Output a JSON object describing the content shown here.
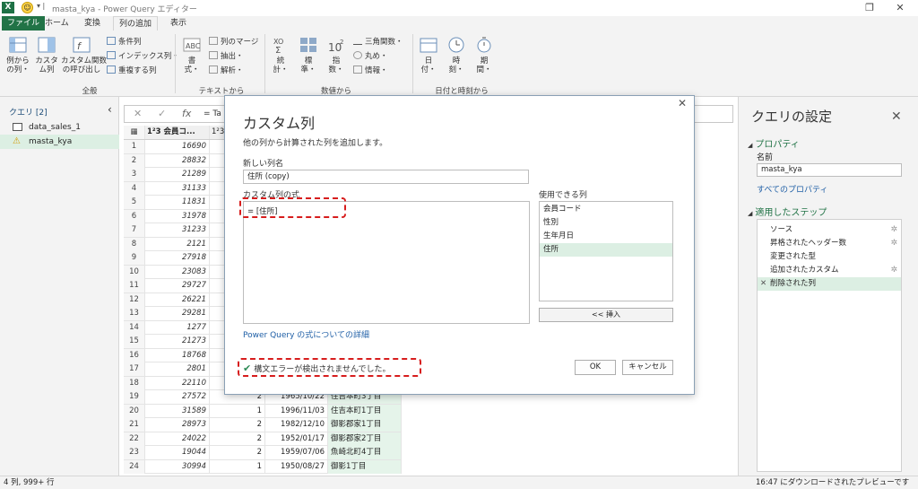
{
  "window": {
    "title": "masta_kya - Power Query エディター",
    "app_icon": "excel-icon",
    "quick_access_icon": "smiley-icon"
  },
  "tabs": [
    "ファイル",
    "ホーム",
    "変換",
    "列の追加",
    "表示"
  ],
  "active_tab": "列の追加",
  "ribbon": {
    "general": {
      "label": "全般",
      "example_column": "例から\nの列・",
      "custom_column": "カスタ\nム列",
      "invoke_function": "カスタム関数\nの呼び出し",
      "conditional_column": "条件列",
      "index_column": "インデックス列・",
      "duplicate_column": "重複する列"
    },
    "text": {
      "label": "テキストから",
      "format": "書\n式・",
      "merge_columns": "列のマージ",
      "extract": "抽出・",
      "parse": "解析・"
    },
    "number": {
      "label": "数値から",
      "statistics": "統\n計・",
      "standard": "標\n準・",
      "scientific": "指\n数・",
      "trigonometry": "三角関数・",
      "rounding": "丸め・",
      "information": "情報・"
    },
    "datetime": {
      "label": "日付と時刻から",
      "date": "日\n付・",
      "time": "時\n刻・",
      "duration": "期\n間・"
    }
  },
  "queries": {
    "header": "クエリ [2]",
    "items": [
      {
        "name": "data_sales_1",
        "icon": "table-icon"
      },
      {
        "name": "masta_kya",
        "icon": "warning-icon"
      }
    ]
  },
  "formula_bar": {
    "cancel": "✕",
    "confirm": "✓",
    "fx": "fx",
    "text": "= Ta"
  },
  "grid": {
    "col1_type": "1²3",
    "col1_header": "会員コ...",
    "col2_type": "1²3",
    "rows": [
      {
        "i": "1",
        "id": "16690",
        "sex": "",
        "dob": "",
        "addr": ""
      },
      {
        "i": "2",
        "id": "28832",
        "sex": "",
        "dob": "",
        "addr": ""
      },
      {
        "i": "3",
        "id": "21289",
        "sex": "",
        "dob": "",
        "addr": ""
      },
      {
        "i": "4",
        "id": "31133",
        "sex": "",
        "dob": "",
        "addr": ""
      },
      {
        "i": "5",
        "id": "11831",
        "sex": "",
        "dob": "",
        "addr": ""
      },
      {
        "i": "6",
        "id": "31978",
        "sex": "",
        "dob": "",
        "addr": ""
      },
      {
        "i": "7",
        "id": "31233",
        "sex": "",
        "dob": "",
        "addr": ""
      },
      {
        "i": "8",
        "id": "2121",
        "sex": "",
        "dob": "",
        "addr": ""
      },
      {
        "i": "9",
        "id": "27918",
        "sex": "",
        "dob": "",
        "addr": ""
      },
      {
        "i": "10",
        "id": "23083",
        "sex": "",
        "dob": "",
        "addr": ""
      },
      {
        "i": "11",
        "id": "29727",
        "sex": "",
        "dob": "",
        "addr": ""
      },
      {
        "i": "12",
        "id": "26221",
        "sex": "",
        "dob": "",
        "addr": ""
      },
      {
        "i": "13",
        "id": "29281",
        "sex": "",
        "dob": "",
        "addr": ""
      },
      {
        "i": "14",
        "id": "1277",
        "sex": "",
        "dob": "",
        "addr": ""
      },
      {
        "i": "15",
        "id": "21273",
        "sex": "",
        "dob": "",
        "addr": ""
      },
      {
        "i": "16",
        "id": "18768",
        "sex": "",
        "dob": "",
        "addr": ""
      },
      {
        "i": "17",
        "id": "2801",
        "sex": "",
        "dob": "",
        "addr": ""
      },
      {
        "i": "18",
        "id": "22110",
        "sex": "",
        "dob": "",
        "addr": ""
      },
      {
        "i": "19",
        "id": "27572",
        "sex": "2",
        "dob": "1965/10/22",
        "addr": "住吉本町3丁目"
      },
      {
        "i": "20",
        "id": "31589",
        "sex": "1",
        "dob": "1996/11/03",
        "addr": "住吉本町1丁目"
      },
      {
        "i": "21",
        "id": "28973",
        "sex": "2",
        "dob": "1982/12/10",
        "addr": "御影郡家1丁目"
      },
      {
        "i": "22",
        "id": "24022",
        "sex": "2",
        "dob": "1952/01/17",
        "addr": "御影郡家2丁目"
      },
      {
        "i": "23",
        "id": "19044",
        "sex": "2",
        "dob": "1959/07/06",
        "addr": "魚崎北町4丁目"
      },
      {
        "i": "24",
        "id": "30994",
        "sex": "1",
        "dob": "1950/08/27",
        "addr": "御影1丁目"
      }
    ]
  },
  "dialog": {
    "title": "カスタム列",
    "description": "他の列から計算された列を追加します。",
    "new_name_label": "新しい列名",
    "new_name_value": "住所 (copy)",
    "formula_label": "カスタム列の式",
    "formula_value": "= [住所]",
    "available_label": "使用できる列",
    "available_columns": [
      "会員コード",
      "性別",
      "生年月日",
      "住所"
    ],
    "selected_column": "住所",
    "insert_button": "<< 挿入",
    "link": "Power Query の式についての詳細",
    "status": "構文エラーが検出されませんでした。",
    "ok": "OK",
    "cancel": "キャンセル"
  },
  "settings": {
    "title": "クエリの設定",
    "properties": "プロパティ",
    "name_label": "名前",
    "name_value": "masta_kya",
    "all_properties": "すべてのプロパティ",
    "applied_steps": "適用したステップ",
    "steps": [
      {
        "label": "ソース",
        "gear": true
      },
      {
        "label": "昇格されたヘッダー数",
        "gear": true
      },
      {
        "label": "変更された型",
        "gear": false
      },
      {
        "label": "追加されたカスタム",
        "gear": true
      },
      {
        "label": "削除された列",
        "gear": false
      }
    ],
    "selected_step": "削除された列"
  },
  "status": {
    "left": "4 列, 999+ 行",
    "right": "16:47 にダウンロードされたプレビューです"
  },
  "colors": {
    "excel_green": "#217346",
    "selection": "#dcefe3",
    "highlight_col": "#e5f4ea",
    "annotation_red": "#d71d1d"
  }
}
